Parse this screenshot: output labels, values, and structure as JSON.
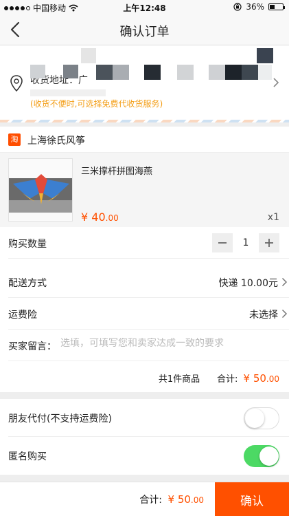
{
  "status": {
    "carrier": "中国移动",
    "time": "上午12:48",
    "battery": "36%"
  },
  "nav": {
    "title": "确认订单",
    "back_icon": "chevron-left-icon"
  },
  "address": {
    "label": "收货地址：广",
    "note": "(收货不便时,可选择免费代收货服务)"
  },
  "shop": {
    "logo_text": "淘",
    "name": "上海徐氏风筝"
  },
  "product": {
    "name": "三米撑杆拼图海燕",
    "price_symbol": "¥",
    "price_main": "40",
    "price_cents": ".00",
    "quantity": "x1"
  },
  "form": {
    "quantity_label": "购买数量",
    "quantity_value": "1",
    "minus": "−",
    "plus": "+",
    "delivery_label": "配送方式",
    "delivery_value": "快递 10.00元",
    "insurance_label": "运费险",
    "insurance_value": "未选择",
    "message_label": "买家留言：",
    "message_placeholder": "选填，可填写您和卖家达成一致的要求",
    "summary_count": "共1件商品",
    "summary_label": "合计:",
    "summary_symbol": "¥",
    "summary_main": "50",
    "summary_cents": ".00"
  },
  "toggles": {
    "friend_pay_label": "朋友代付(不支持运费险)",
    "friend_pay_on": false,
    "anonymous_label": "匿名购买",
    "anonymous_on": true
  },
  "bottom": {
    "total_label": "合计:",
    "total_symbol": "¥",
    "total_main": "50",
    "total_cents": ".00",
    "confirm_label": "确认"
  },
  "colors": {
    "accent": "#ff5000",
    "toggle_on": "#4cd964",
    "note": "#f39c12"
  }
}
